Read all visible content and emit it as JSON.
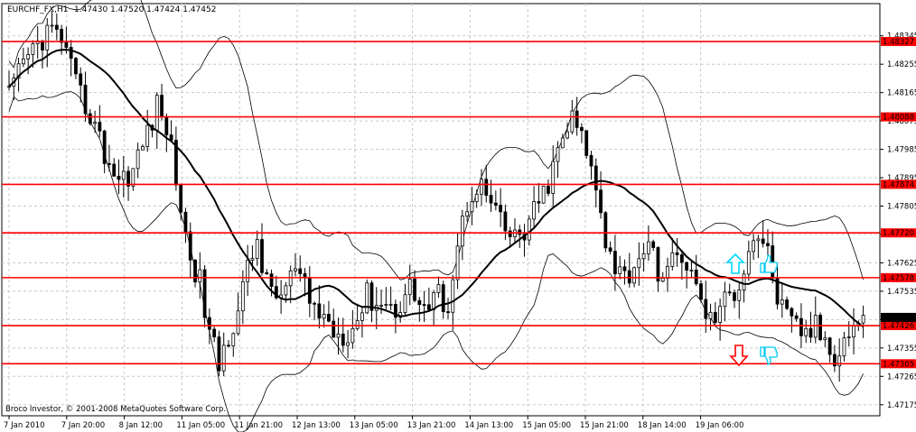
{
  "header": {
    "symbol": "EURCHF_FX,H1",
    "ohlc": "1.47430 1.47520 1.47424 1.47452"
  },
  "footer": {
    "copyright": "Broco Investor, © 2001-2008 MetaQuotes Software Corp."
  },
  "colors": {
    "background": "#ffffff",
    "grid": "#c8c8c8",
    "level_line": "#ff0000",
    "level_label_bg": "#ff0000",
    "candle": "#000000",
    "ma": "#000000",
    "arrow_up": "#00d8ff",
    "arrow_down": "#ff0000",
    "hand": "#00c8f0"
  },
  "annotations": [
    {
      "icon": "arrow-up-icon",
      "hand": "thumbs-up-hand-icon"
    },
    {
      "icon": "arrow-down-icon",
      "hand": "thumbs-down-hand-icon"
    }
  ],
  "chart_data": {
    "type": "candlestick",
    "ylim": [
      1.4714,
      1.4841
    ],
    "y_ticks": [
      "1.48345",
      "1.48255",
      "1.48165",
      "1.48075",
      "1.47985",
      "1.47895",
      "1.47805",
      "1.47715",
      "1.47625",
      "1.47535",
      "1.47445",
      "1.47355",
      "1.47265",
      "1.47175"
    ],
    "x_ticks": [
      "7 Jan 2010",
      "7 Jan 20:00",
      "8 Jan 12:00",
      "11 Jan 05:00",
      "11 Jan 21:00",
      "12 Jan 13:00",
      "13 Jan 05:00",
      "13 Jan 21:00",
      "14 Jan 13:00",
      "15 Jan 05:00",
      "15 Jan 21:00",
      "18 Jan 14:00",
      "19 Jan 06:00"
    ],
    "grid": true,
    "levels": [
      {
        "value": 1.48327,
        "label": "1.48327"
      },
      {
        "value": 1.48088,
        "label": "1.48088"
      },
      {
        "value": 1.47874,
        "label": "1.47874"
      },
      {
        "value": 1.4772,
        "label": "1.47720"
      },
      {
        "value": 1.47578,
        "label": "1.47578"
      },
      {
        "value": 1.47426,
        "label": "1.47426"
      },
      {
        "value": 1.47305,
        "label": "1.47305"
      }
    ],
    "current_price": {
      "value": 1.47452,
      "label": "1.47452"
    },
    "trend_anchors": [
      [
        0,
        1.4815
      ],
      [
        4,
        1.4828
      ],
      [
        8,
        1.4836
      ],
      [
        11,
        1.4834
      ],
      [
        14,
        1.4818
      ],
      [
        17,
        1.481
      ],
      [
        20,
        1.4797
      ],
      [
        23,
        1.4789
      ],
      [
        26,
        1.4792
      ],
      [
        28,
        1.48
      ],
      [
        31,
        1.4812
      ],
      [
        33,
        1.4806
      ],
      [
        35,
        1.479
      ],
      [
        37,
        1.477
      ],
      [
        40,
        1.4756
      ],
      [
        42,
        1.474
      ],
      [
        44,
        1.473
      ],
      [
        46,
        1.474
      ],
      [
        48,
        1.4748
      ],
      [
        50,
        1.476
      ],
      [
        52,
        1.477
      ],
      [
        54,
        1.4755
      ],
      [
        57,
        1.4752
      ],
      [
        60,
        1.476
      ],
      [
        63,
        1.475
      ],
      [
        66,
        1.4745
      ],
      [
        69,
        1.474
      ],
      [
        72,
        1.4742
      ],
      [
        75,
        1.4752
      ],
      [
        78,
        1.475
      ],
      [
        81,
        1.4748
      ],
      [
        84,
        1.4755
      ],
      [
        86,
        1.475
      ],
      [
        88,
        1.4748
      ],
      [
        90,
        1.4752
      ],
      [
        92,
        1.475
      ],
      [
        94,
        1.4768
      ],
      [
        96,
        1.4782
      ],
      [
        98,
        1.4788
      ],
      [
        100,
        1.4784
      ],
      [
        102,
        1.4778
      ],
      [
        104,
        1.4772
      ],
      [
        106,
        1.477
      ],
      [
        108,
        1.4772
      ],
      [
        110,
        1.4778
      ],
      [
        112,
        1.4784
      ],
      [
        114,
        1.4792
      ],
      [
        116,
        1.4802
      ],
      [
        118,
        1.4808
      ],
      [
        120,
        1.4802
      ],
      [
        122,
        1.4792
      ],
      [
        124,
        1.4782
      ],
      [
        125,
        1.477
      ],
      [
        127,
        1.4762
      ],
      [
        129,
        1.4758
      ],
      [
        131,
        1.4762
      ],
      [
        133,
        1.4768
      ],
      [
        135,
        1.4764
      ],
      [
        137,
        1.4758
      ],
      [
        139,
        1.4762
      ],
      [
        141,
        1.4766
      ],
      [
        143,
        1.4758
      ],
      [
        145,
        1.475
      ],
      [
        147,
        1.4744
      ],
      [
        149,
        1.4748
      ],
      [
        151,
        1.4752
      ],
      [
        153,
        1.4756
      ],
      [
        155,
        1.4768
      ],
      [
        157,
        1.4772
      ],
      [
        159,
        1.4765
      ],
      [
        161,
        1.4752
      ],
      [
        163,
        1.4744
      ],
      [
        165,
        1.4742
      ],
      [
        167,
        1.474
      ],
      [
        169,
        1.4742
      ],
      [
        171,
        1.4738
      ],
      [
        173,
        1.4734
      ],
      [
        175,
        1.4738
      ],
      [
        177,
        1.4743
      ],
      [
        179,
        1.4745
      ]
    ]
  }
}
